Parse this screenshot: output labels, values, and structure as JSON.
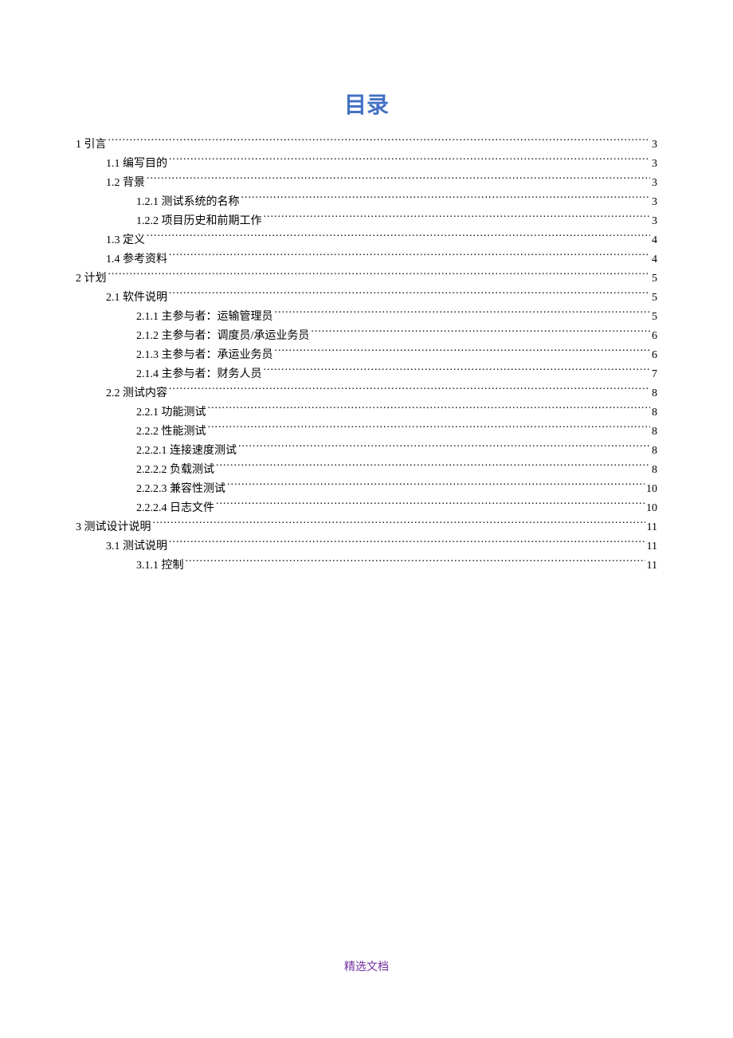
{
  "title": "目录",
  "footer": "精选文档",
  "toc": [
    {
      "level": 0,
      "label": "1 引言",
      "page": "3"
    },
    {
      "level": 1,
      "label": "1.1 编写目的",
      "page": "3"
    },
    {
      "level": 1,
      "label": "1.2 背景",
      "page": "3"
    },
    {
      "level": 2,
      "label": "1.2.1 测试系统的名称",
      "page": "3"
    },
    {
      "level": 2,
      "label": "1.2.2 项目历史和前期工作",
      "page": "3"
    },
    {
      "level": 1,
      "label": "1.3 定义",
      "page": "4"
    },
    {
      "level": 1,
      "label": "1.4 参考资料",
      "page": "4"
    },
    {
      "level": 0,
      "label": "2 计划",
      "page": "5"
    },
    {
      "level": 1,
      "label": "2.1 软件说明",
      "page": "5"
    },
    {
      "level": 2,
      "label": "2.1.1 主参与者：运输管理员",
      "page": "5"
    },
    {
      "level": 2,
      "label": "2.1.2 主参与者：调度员/承运业务员 ",
      "page": "6"
    },
    {
      "level": 2,
      "label": "2.1.3 主参与者：承运业务员",
      "page": "6"
    },
    {
      "level": 2,
      "label": "2.1.4 主参与者：财务人员",
      "page": "7"
    },
    {
      "level": 1,
      "label": "2.2 测试内容",
      "page": "8"
    },
    {
      "level": 2,
      "label": "2.2.1 功能测试",
      "page": "8"
    },
    {
      "level": 2,
      "label": "2.2.2 性能测试",
      "page": "8"
    },
    {
      "level": 2,
      "label": "2.2.2.1 连接速度测试",
      "page": "8"
    },
    {
      "level": 2,
      "label": "2.2.2.2 负载测试",
      "page": "8"
    },
    {
      "level": 2,
      "label": "2.2.2.3 兼容性测试",
      "page": "10"
    },
    {
      "level": 2,
      "label": "2.2.2.4  日志文件",
      "page": "10"
    },
    {
      "level": 0,
      "label": "3 测试设计说明",
      "page": "11"
    },
    {
      "level": 1,
      "label": "3.1 测试说明",
      "page": "11"
    },
    {
      "level": 2,
      "label": "3.1.1 控制",
      "page": "11"
    }
  ]
}
